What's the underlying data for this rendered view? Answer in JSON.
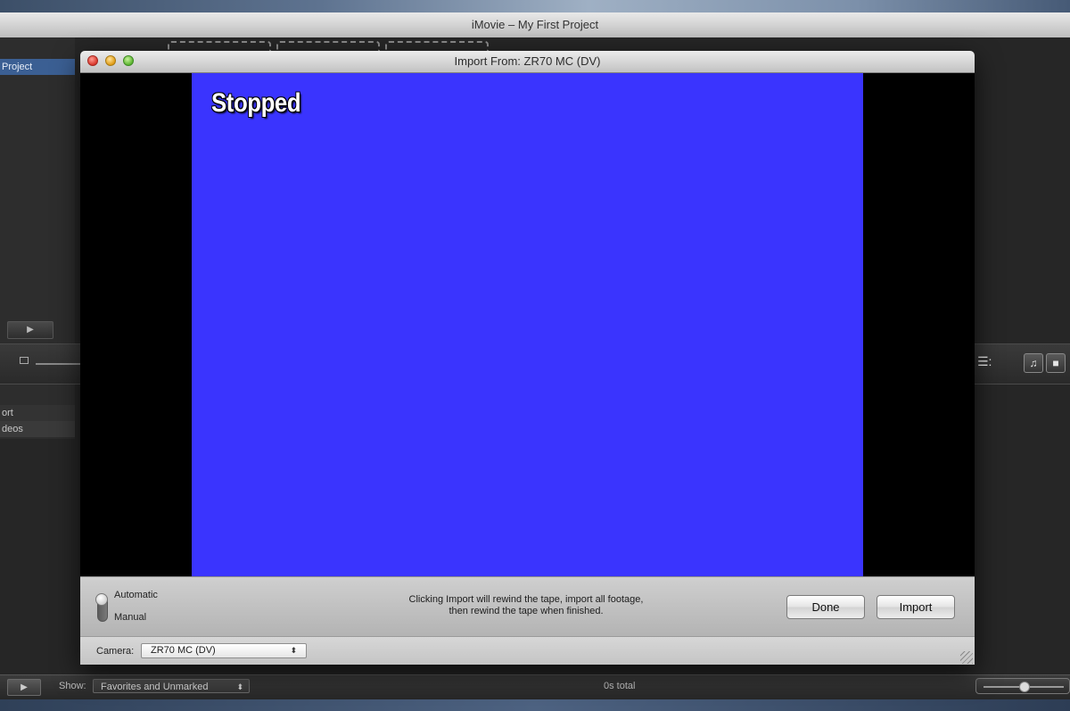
{
  "app_window": {
    "title": "iMovie – My First Project",
    "sidebar": {
      "project_item": "Project",
      "import_item": "ort",
      "videos_item": "deos"
    },
    "toolbar_left": {
      "play_symbol": "▶",
      "zoom_icon": "zoom-out-icon"
    },
    "toolbar_right": {
      "lines_symbol": "☰:",
      "music_symbol": "♫",
      "camera_symbol": "■"
    },
    "bottom_bar": {
      "play_symbol": "▶",
      "show_label": "Show:",
      "show_value": "Favorites and Unmarked",
      "select_arrows": "⬍",
      "total_text": "0s total"
    }
  },
  "import_dialog": {
    "title": "Import From: ZR70 MC (DV)",
    "status_text": "Stopped",
    "colors": {
      "video_frame": "#3a34fe",
      "letterbox": "#000000"
    },
    "mode_switch": {
      "options": [
        "Automatic",
        "Manual"
      ],
      "selected": "Automatic"
    },
    "message_lines": [
      "Clicking Import will rewind the tape, import all footage,",
      "then rewind the tape when finished."
    ],
    "buttons": {
      "done": "Done",
      "import": "Import"
    },
    "camera": {
      "label": "Camera:",
      "value": "ZR70 MC (DV)",
      "select_arrows": "⬍"
    }
  }
}
